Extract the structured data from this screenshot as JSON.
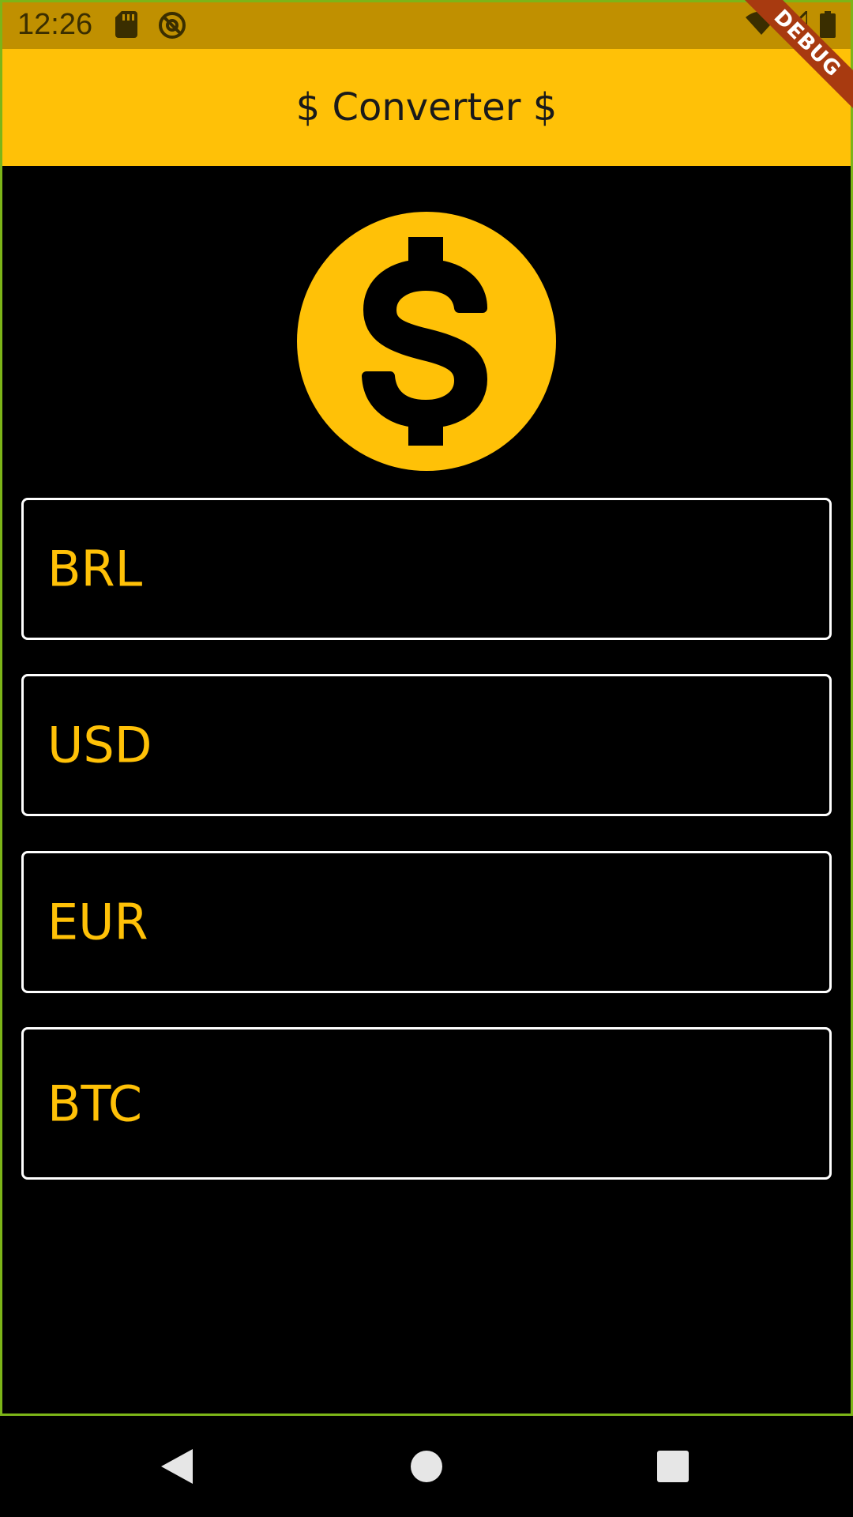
{
  "status_bar": {
    "time": "12:26",
    "icons_left": [
      "sd-card-icon",
      "at-sign-icon"
    ],
    "icons_right": [
      "wifi-icon",
      "signal-icon",
      "battery-icon"
    ]
  },
  "debug_banner": "DEBUG",
  "app_bar": {
    "title": "$ Converter $"
  },
  "logo": {
    "icon": "dollar-coin-icon"
  },
  "fields": [
    {
      "label": "BRL"
    },
    {
      "label": "USD"
    },
    {
      "label": "EUR"
    },
    {
      "label": "BTC"
    }
  ],
  "nav_bar": {
    "buttons": [
      "back-icon",
      "home-icon",
      "recents-icon"
    ]
  },
  "colors": {
    "accent": "#ffc107",
    "status_bar": "#c09000",
    "background": "#000000",
    "field_border": "#ffffff"
  }
}
